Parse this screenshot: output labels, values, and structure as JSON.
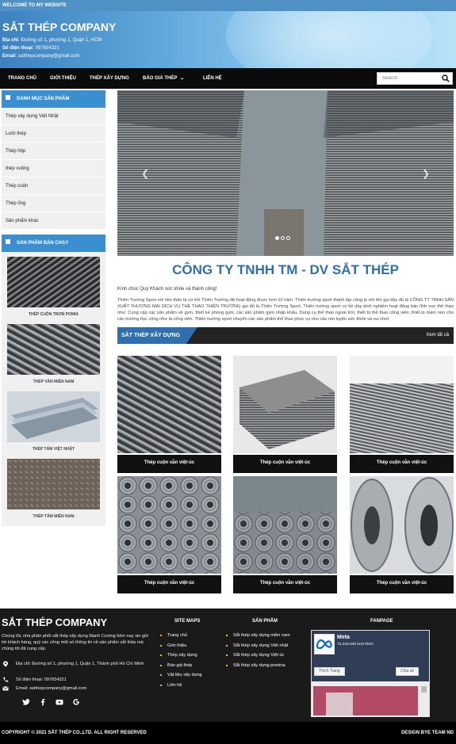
{
  "topbar": {
    "welcome": "WELCOME TO MY WEBSITE"
  },
  "header": {
    "brand": "SẮT THÉP COMPANY",
    "address_label": "Địa chỉ:",
    "address": "Đường số 1, phường 1, Quận 1, HCM",
    "phone_label": "Số điện thoại:",
    "phone": "097654321",
    "email_label": "Email:",
    "email": "satthepcompany@gmail.com"
  },
  "nav": {
    "items": [
      "TRANG CHỦ",
      "GIỚI THIỆU",
      "THÉP XÂY DỰNG",
      "BÁO GIÁ THÉP",
      "LIÊN HỆ"
    ],
    "search_placeholder": "Search"
  },
  "sidebar": {
    "categories_title": "DANH MỤC SẢN PHẨM",
    "categories": [
      "Thép xây dựng Việt Nhật",
      "Lưới thép",
      "Thép hộp",
      "thép vuông",
      "Thép cuộn",
      "Thép ống",
      "Sản phẩm khác"
    ],
    "bestsellers_title": "SẢN PHẨM BÁN CHẠY",
    "bestsellers": [
      "THÉP CUỘN TRƠN POMIA",
      "THÉP VẰN MIỀN NAM",
      "THÉP TẤM VIỆT NHẬT",
      "THÉP TẤM MIỀN NAM"
    ]
  },
  "main": {
    "company_title": "CÔNG TY TNHH TM - DV SẮT THÉP",
    "greeting": "Kính chúc Quý Khách sức khỏe và thành công!",
    "intro": "Thiên Trường Sport với tiền thân là cơ khí Thiên Trường đã hoạt động được hơn 10 năm. Thiên trường sport thành lập công ty với tên gọi đầy đủ là CÔNG TY TNHH SẢN XUẤT THƯƠNG MẠI DỊCH VỤ THỂ THAO THIÊN TRƯỜNG gọi tắt là Thiên Trường Sport. Thiên trường sport có bề dày kinh nghiệm hoạt động bán lĩnh vực thể thao như: Cung cấp các sản phẩm về gym, thiết kế phòng gym, các sản phẩm gym nhập khẩu, Dụng cụ thể thao ngoài trời, thiết bị thể thao công viên, thiết bị mầm non cho các trường học công như lá công viên. Thiên trường sport chuyên các sản phẩm thể thao phục vụ nhu cầu rèn luyện sức khỏe và vui chơi.",
    "section_title": "SẮT THÉP XÂY DỰNG",
    "view_all": "Xem tất cả",
    "products": [
      "Thép cuộn vằn việt-úc",
      "Thép cuộn vằn việt-úc",
      "Thép cuộn vằn việt-úc",
      "Thép cuộn vằn việt-úc",
      "Thép cuộn vằn việt-úc",
      "Thép cuộn vằn việt-úc"
    ]
  },
  "footer": {
    "brand": "SẮT THÉP COMPANY",
    "description": "Chúng tôi, nhà phân phối sắt thép xây dựng Mạnh Cường hôm nay xin gửi tới khách hàng, quý các công một số thông tin về sản phẩm sắt thép mà chúng tôi đã cung cấp.",
    "address": "Địa chỉ: Đường số 1, phường 1, Quận 1, Thành phố Hồ Chí Minh",
    "phone": "Số điện thoại: 097654321",
    "email": "Email: satthepcompany@gmail.com",
    "sitemap_title": "SITE MAPS",
    "sitemap": [
      "Trang chủ",
      "Giới thiệu",
      "Thép xây dựng",
      "Báo giá thép",
      "Vật liệu xây dựng",
      "Liên hệ"
    ],
    "products_title": "SẢN PHẨM",
    "products": [
      "Sắt thép xây dựng miền nam",
      "Sắt thép xây dựng Việt nhật",
      "Sắt thép xây dựng Việt úc",
      "Sắt thép xây dựng pomina"
    ],
    "fanpage_title": "FANPAGE",
    "fb_name": "Meta",
    "fb_likes": "72.233.840 lượt thích",
    "fb_like_btn": "Thích Trang",
    "fb_share_btn": "Chia sẻ",
    "copyright": "COPYRIGHT © 2021 SẮT THÉP CO.,LTD. ALL RIGHT RESERVED",
    "design": "DESIGN BYE TEAM ND"
  },
  "icons": {
    "search": "search-icon",
    "location": "map-pin-icon",
    "phone": "phone-icon",
    "email": "mail-icon",
    "social": [
      "twitter-icon",
      "facebook-icon",
      "youtube-icon",
      "google-icon"
    ]
  },
  "colors": {
    "accent": "#2f6fad",
    "nav": "#0b0b0b",
    "sidebar_head": "#3a8fd0",
    "footer": "#1a1a1a",
    "bullet": "#f2c200"
  }
}
